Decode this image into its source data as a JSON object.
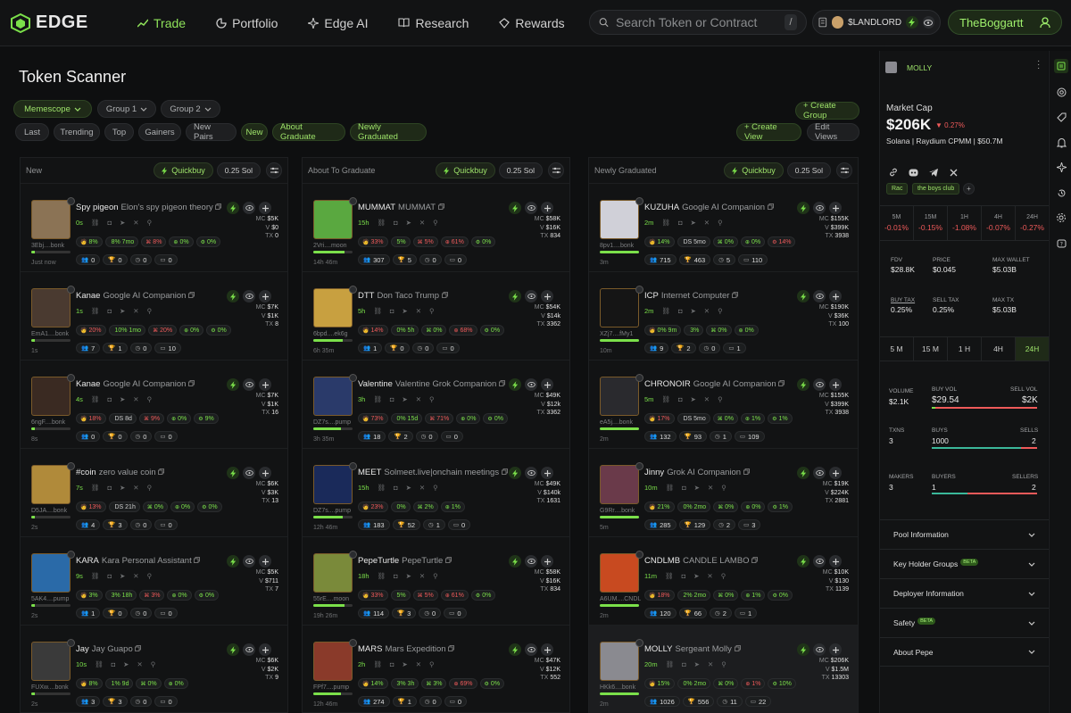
{
  "nav": {
    "brand": "EDGE",
    "items": [
      {
        "label": "Trade"
      },
      {
        "label": "Portfolio"
      },
      {
        "label": "Edge AI"
      },
      {
        "label": "Research"
      },
      {
        "label": "Rewards"
      }
    ],
    "search_placeholder": "Search Token or Contract",
    "search_kbd": "/",
    "wallet_label": "$LANDLORD",
    "user": "TheBoggartt"
  },
  "page_title": "Token Scanner",
  "filters": {
    "memescope": "Memescope",
    "group1": "Group 1",
    "group2": "Group 2",
    "create_group": "+ Create Group",
    "tabs": [
      "Last",
      "Trending",
      "Top",
      "Gainers",
      "New Pairs",
      "New",
      "About Graduate",
      "Newly Graduated"
    ],
    "create_view": "+ Create View",
    "edit_views": "Edit Views"
  },
  "colors": {
    "accent": "#7be04a",
    "negative": "#ef5a5a"
  },
  "columns": [
    {
      "title": "New",
      "quickbuy": "Quickbuy",
      "sol": "0.25 Sol",
      "rows": [
        {
          "ticker": "Spy pigeon",
          "name": "Elon's spy pigeon theory",
          "addr": "3Ebj....bonk",
          "age": "Just now",
          "bar": 0.1,
          "time": "0s",
          "mc": "$5K",
          "v": "$0",
          "tx": "0",
          "p": [
            [
              "8%",
              "g"
            ],
            [
              "8% 7mo",
              "g"
            ],
            [
              "8%",
              "r"
            ],
            [
              "0%",
              "g"
            ],
            [
              "0%",
              "g"
            ]
          ],
          "c": [
            "0",
            "0",
            "0",
            "0"
          ],
          "thumb": "#8b7355"
        },
        {
          "ticker": "Kanae",
          "name": "Google AI Companion",
          "addr": "EmA1....bonk",
          "age": "1s",
          "bar": 0.1,
          "time": "1s",
          "mc": "$7K",
          "v": "$1K",
          "tx": "8",
          "p": [
            [
              "20%",
              "r"
            ],
            [
              "10% 1mo",
              "g"
            ],
            [
              "20%",
              "r"
            ],
            [
              "0%",
              "g"
            ],
            [
              "0%",
              "g"
            ]
          ],
          "c": [
            "7",
            "1",
            "0",
            "10"
          ],
          "thumb": "#4a3a30"
        },
        {
          "ticker": "Kanae",
          "name": "Google AI Companion",
          "addr": "6ngF....bonk",
          "age": "8s",
          "bar": 0.1,
          "time": "4s",
          "mc": "$7K",
          "v": "$1K",
          "tx": "16",
          "p": [
            [
              "18%",
              "r"
            ],
            [
              "DS 8d",
              ""
            ],
            [
              "9%",
              "r"
            ],
            [
              "0%",
              "g"
            ],
            [
              "9%",
              "g"
            ]
          ],
          "c": [
            "0",
            "0",
            "0",
            "0"
          ],
          "thumb": "#3a2a22"
        },
        {
          "ticker": "#coin",
          "name": "zero value coin",
          "addr": "D5JA....bonk",
          "age": "2s",
          "bar": 0.1,
          "time": "7s",
          "mc": "$6K",
          "v": "$3K",
          "tx": "13",
          "p": [
            [
              "13%",
              "r"
            ],
            [
              "DS 21h",
              ""
            ],
            [
              "0%",
              "g"
            ],
            [
              "0%",
              "g"
            ],
            [
              "0%",
              "g"
            ]
          ],
          "c": [
            "4",
            "3",
            "0",
            "0"
          ],
          "thumb": "#b08a3a"
        },
        {
          "ticker": "KARA",
          "name": "Kara Personal Assistant",
          "addr": "5AK4....pump",
          "age": "2s",
          "bar": 0.1,
          "time": "9s",
          "mc": "$5K",
          "v": "$711",
          "tx": "7",
          "p": [
            [
              "3%",
              "g"
            ],
            [
              "3% 18h",
              "g"
            ],
            [
              "3%",
              "r"
            ],
            [
              "0%",
              "g"
            ],
            [
              "0%",
              "g"
            ]
          ],
          "c": [
            "1",
            "0",
            "0",
            "0"
          ],
          "thumb": "#2a6aa8"
        },
        {
          "ticker": "Jay",
          "name": "Jay Guapo",
          "addr": "FUXw....bonk",
          "age": "2s",
          "bar": 0.1,
          "time": "10s",
          "mc": "$6K",
          "v": "$2K",
          "tx": "9",
          "p": [
            [
              "8%",
              "g"
            ],
            [
              "1% 9d",
              "g"
            ],
            [
              "0%",
              "g"
            ],
            [
              "0%",
              "g"
            ]
          ],
          "c": [
            "3",
            "3",
            "0",
            "0"
          ],
          "thumb": "#3a3a3a"
        }
      ]
    },
    {
      "title": "About To Graduate",
      "quickbuy": "Quickbuy",
      "sol": "0.25 Sol",
      "rows": [
        {
          "ticker": "MUMMAT",
          "name": "MUMMAT",
          "addr": "2Vri....moon",
          "age": "14h 46m",
          "bar": 0.8,
          "time": "15h",
          "mc": "$58K",
          "v": "$16K",
          "tx": "834",
          "p": [
            [
              "33%",
              "r"
            ],
            [
              "5%",
              "g"
            ],
            [
              "5%",
              "r"
            ],
            [
              "61%",
              "r"
            ],
            [
              "0%",
              "g"
            ]
          ],
          "c": [
            "307",
            "5",
            "0",
            "0"
          ],
          "thumb": "#5aa840"
        },
        {
          "ticker": "DTT",
          "name": "Don Taco Trump",
          "addr": "6bpd....ek6g",
          "age": "6h 35m",
          "bar": 0.75,
          "time": "5h",
          "mc": "$54K",
          "v": "$14k",
          "tx": "3362",
          "p": [
            [
              "14%",
              "r"
            ],
            [
              "0% 5h",
              "g"
            ],
            [
              "0%",
              "g"
            ],
            [
              "68%",
              "r"
            ],
            [
              "0%",
              "g"
            ]
          ],
          "c": [
            "1",
            "0",
            "0",
            "0"
          ],
          "thumb": "#c8a040"
        },
        {
          "ticker": "Valentine",
          "name": "Valentine Grok Companion",
          "addr": "DZ7s....pump",
          "age": "3h 35m",
          "bar": 0.7,
          "time": "3h",
          "mc": "$49K",
          "v": "$12k",
          "tx": "3362",
          "p": [
            [
              "73%",
              "r"
            ],
            [
              "0% 15d",
              "g"
            ],
            [
              "71%",
              "r"
            ],
            [
              "0%",
              "g"
            ],
            [
              "0%",
              "g"
            ]
          ],
          "c": [
            "18",
            "2",
            "0",
            "0"
          ],
          "thumb": "#2a3a6a"
        },
        {
          "ticker": "MEET",
          "name": "Solmeet.live|onchain meetings",
          "addr": "DZ7s....pump",
          "age": "12h 46m",
          "bar": 0.75,
          "time": "15h",
          "mc": "$49K",
          "v": "$140k",
          "tx": "1631",
          "p": [
            [
              "23%",
              "r"
            ],
            [
              "0%",
              "g"
            ],
            [
              "2%",
              "g"
            ],
            [
              "1%",
              "g"
            ]
          ],
          "c": [
            "183",
            "52",
            "1",
            "0"
          ],
          "thumb": "#1a2a5a"
        },
        {
          "ticker": "PepeTurtle",
          "name": "PepeTurtle",
          "addr": "55rE....moon",
          "age": "19h 26m",
          "bar": 0.8,
          "time": "18h",
          "mc": "$58K",
          "v": "$16K",
          "tx": "834",
          "p": [
            [
              "33%",
              "r"
            ],
            [
              "5%",
              "g"
            ],
            [
              "5%",
              "r"
            ],
            [
              "61%",
              "r"
            ],
            [
              "0%",
              "g"
            ]
          ],
          "c": [
            "114",
            "3",
            "0",
            "0"
          ],
          "thumb": "#7a8a3a"
        },
        {
          "ticker": "MARS",
          "name": "Mars Expedition",
          "addr": "FPf7....pump",
          "age": "12h 46m",
          "bar": 0.7,
          "time": "2h",
          "mc": "$47K",
          "v": "$12K",
          "tx": "552",
          "p": [
            [
              "14%",
              "g"
            ],
            [
              "3% 3h",
              "g"
            ],
            [
              "3%",
              "g"
            ],
            [
              "69%",
              "r"
            ],
            [
              "0%",
              "g"
            ]
          ],
          "c": [
            "274",
            "1",
            "0",
            "0"
          ],
          "thumb": "#8a3a2a"
        }
      ]
    },
    {
      "title": "Newly Graduated",
      "quickbuy": "Quickbuy",
      "sol": "0.25 Sol",
      "rows": [
        {
          "ticker": "KUZUHA",
          "name": "Google AI Companion",
          "addr": "8pv1....bonk",
          "age": "3m",
          "bar": 1,
          "time": "2m",
          "mc": "$155K",
          "v": "$399K",
          "tx": "3938",
          "p": [
            [
              "14%",
              "g"
            ],
            [
              "DS 5mo",
              ""
            ],
            [
              "0%",
              "g"
            ],
            [
              "0%",
              "g"
            ],
            [
              "14%",
              "r"
            ]
          ],
          "c": [
            "715",
            "463",
            "5",
            "110"
          ],
          "thumb": "#d0d0d8"
        },
        {
          "ticker": "ICP",
          "name": "Internet Computer",
          "addr": "XZj7....fMy1",
          "age": "10m",
          "bar": 1,
          "time": "2m",
          "mc": "$190K",
          "v": "$36K",
          "tx": "100",
          "p": [
            [
              "0% 9m",
              "g"
            ],
            [
              "3%",
              "g"
            ],
            [
              "0%",
              "g"
            ],
            [
              "0%",
              "g"
            ]
          ],
          "c": [
            "9",
            "2",
            "0",
            "1"
          ],
          "thumb": "#151515"
        },
        {
          "ticker": "CHRONOIR",
          "name": "Google AI Companion",
          "addr": "eA5j....bonk",
          "age": "2m",
          "bar": 1,
          "time": "5m",
          "mc": "$155K",
          "v": "$399K",
          "tx": "3938",
          "p": [
            [
              "17%",
              "r"
            ],
            [
              "DS 5mo",
              ""
            ],
            [
              "0%",
              "g"
            ],
            [
              "1%",
              "g"
            ],
            [
              "1%",
              "g"
            ]
          ],
          "c": [
            "132",
            "93",
            "1",
            "109"
          ],
          "thumb": "#2a2a2e"
        },
        {
          "ticker": "Jinny",
          "name": "Grok AI Companion",
          "addr": "G9Rr....bonk",
          "age": "5m",
          "bar": 1,
          "time": "10m",
          "mc": "$19K",
          "v": "$224K",
          "tx": "2881",
          "p": [
            [
              "21%",
              "g"
            ],
            [
              "0% 2mo",
              "g"
            ],
            [
              "0%",
              "g"
            ],
            [
              "0%",
              "g"
            ],
            [
              "1%",
              "g"
            ]
          ],
          "c": [
            "285",
            "129",
            "2",
            "3"
          ],
          "thumb": "#6a3a4a"
        },
        {
          "ticker": "CNDLMB",
          "name": "CANDLE LAMBO",
          "addr": "A6UM....CNDL",
          "age": "2m",
          "bar": 1,
          "time": "11m",
          "mc": "$10K",
          "v": "$130",
          "tx": "1139",
          "p": [
            [
              "18%",
              "r"
            ],
            [
              "2% 2mo",
              "g"
            ],
            [
              "0%",
              "g"
            ],
            [
              "1%",
              "g"
            ],
            [
              "0%",
              "g"
            ]
          ],
          "c": [
            "120",
            "66",
            "2",
            "1"
          ],
          "thumb": "#c84a20"
        },
        {
          "ticker": "MOLLY",
          "name": "Sergeant Molly",
          "addr": "HKk6....bonk",
          "age": "2m",
          "bar": 1,
          "time": "20m",
          "mc": "$206K",
          "v": "$1.5M",
          "tx": "13303",
          "p": [
            [
              "15%",
              "g"
            ],
            [
              "0% 2mo",
              "g"
            ],
            [
              "0%",
              "g"
            ],
            [
              "1%",
              "r"
            ],
            [
              "10%",
              "g"
            ]
          ],
          "c": [
            "1026",
            "556",
            "11",
            "22"
          ],
          "thumb": "#8a8a90",
          "hl": true
        }
      ]
    }
  ],
  "detail": {
    "ticker": "MOLLY",
    "mc_label": "Market Cap",
    "mc": "$206K",
    "mc_change": "0.27%",
    "dex": "Solana | Raydium CPMM | $50.7M",
    "tags": [
      "Rac",
      "the boys club"
    ],
    "tf": [
      {
        "k": "5M",
        "v": "-0.01%"
      },
      {
        "k": "15M",
        "v": "-0.15%"
      },
      {
        "k": "1H",
        "v": "-1.08%"
      },
      {
        "k": "4H",
        "v": "-0.07%"
      },
      {
        "k": "24H",
        "v": "-0.27%"
      }
    ],
    "fdv_l": "FDV",
    "fdv": "$28.8K",
    "price_l": "PRICE",
    "price": "$0.045",
    "maxw_l": "MAX WALLET",
    "maxw": "$5.03B",
    "buytax_l": "BUY TAX",
    "buytax": "0.25%",
    "selltax_l": "SELL TAX",
    "selltax": "0.25%",
    "maxtx_l": "MAX TX",
    "maxtx": "$5.03B",
    "tabs": [
      "5 M",
      "15 M",
      "1 H",
      "4H",
      "24H"
    ],
    "vol_l": "VOLUME",
    "vol": "$2.1K",
    "buyvol_l": "BUY VOL",
    "buyvol": "$29.54",
    "sellvol_l": "SELL VOL",
    "sellvol": "$2K",
    "txns_l": "TXNS",
    "txns": "3",
    "buys_l": "BUYS",
    "buys": "1000",
    "sells_l": "SELLS",
    "sells": "2",
    "makers_l": "MAKERS",
    "makers": "3",
    "buyers_l": "BUYERS",
    "buyers": "1",
    "sellers_l": "SELLERS",
    "sellers": "2",
    "acc": [
      {
        "l": "Pool Information",
        "beta": ""
      },
      {
        "l": "Key Holder Groups",
        "beta": "BETA"
      },
      {
        "l": "Deployer Information",
        "beta": ""
      },
      {
        "l": "Safety",
        "beta": "BETA"
      },
      {
        "l": "About Pepe",
        "beta": ""
      }
    ]
  }
}
